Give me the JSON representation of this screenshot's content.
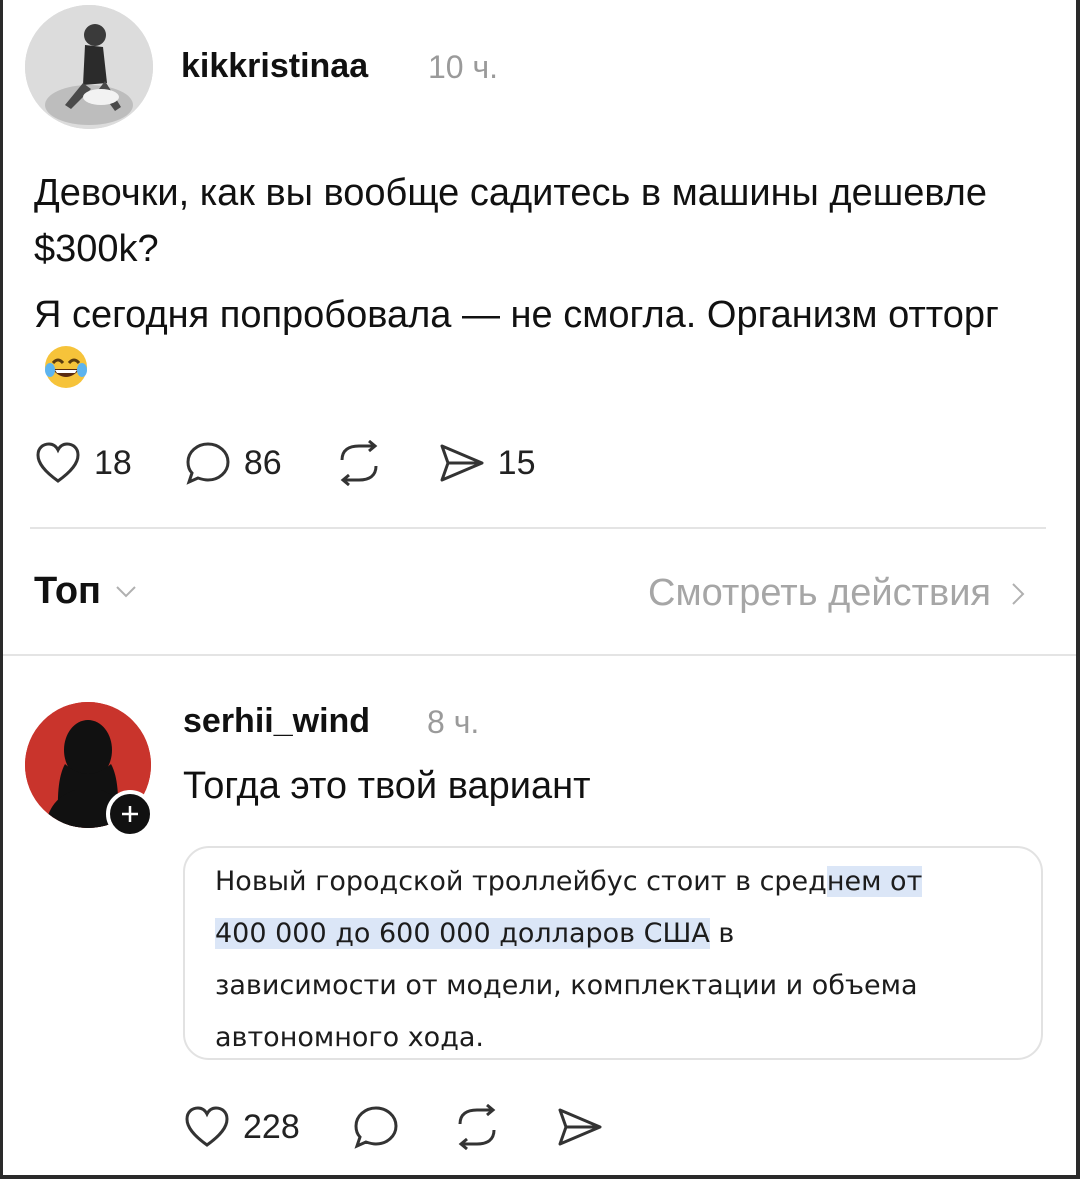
{
  "post": {
    "username": "kikkristinaa",
    "time": "10 ч.",
    "text_line1": "Девочки, как вы вообще садитесь в машины дешевле $300k?",
    "text_line2": "Я сегодня попробовала — не смогла. Организм отторг",
    "emoji": "face-with-tears-of-joy",
    "likes": "18",
    "comments": "86",
    "shares": "15"
  },
  "filters": {
    "sort_label": "Топ",
    "view_activity_label": "Смотреть действия"
  },
  "reply": {
    "username": "serhii_wind",
    "time": "8 ч.",
    "text": "Тогда это твой вариант",
    "quote": {
      "before": "Новый городской троллейбус стоит в сред",
      "highlight_a": "нем от",
      "highlight_b": "400 000 до 600 000 долларов США",
      "after_b": " в",
      "line3": "зависимости от модели, комплектации и объема",
      "line4": "автономного хода."
    },
    "likes": "228"
  },
  "colors": {
    "accent_avatar": "#c9342c",
    "highlight": "#dbe6f7",
    "muted_text": "#9a9a9a"
  }
}
